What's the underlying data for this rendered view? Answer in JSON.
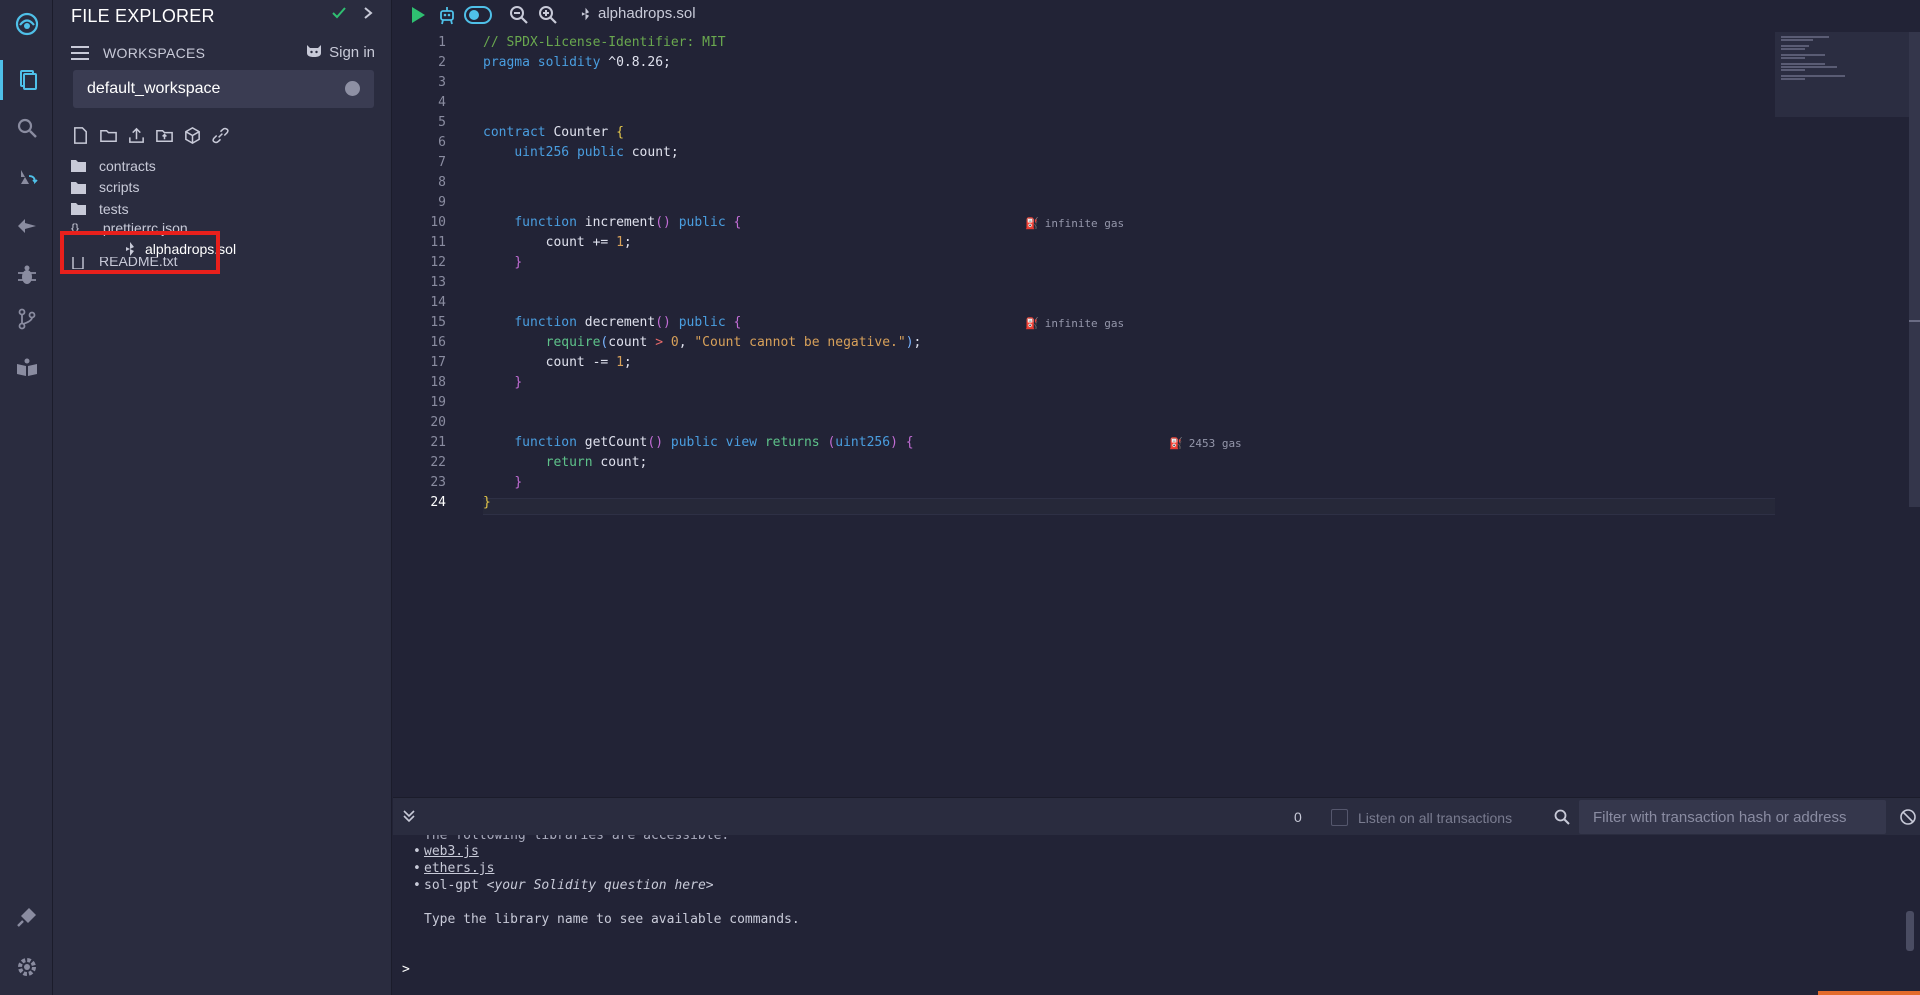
{
  "side_panel": {
    "title": "FILE EXPLORER",
    "workspaces_label": "WORKSPACES",
    "sign_in": "Sign in",
    "workspace_name": "default_workspace",
    "tree": [
      {
        "type": "folder",
        "name": "contracts"
      },
      {
        "type": "folder",
        "name": "scripts"
      },
      {
        "type": "folder",
        "name": "tests"
      },
      {
        "type": "file",
        "name": ".prettierrc.json"
      },
      {
        "type": "sol",
        "name": "alphadrops.sol"
      },
      {
        "type": "file",
        "name": "README.txt"
      }
    ]
  },
  "toolbar": {
    "open_file": "alphadrops.sol"
  },
  "editor": {
    "current_line": "24",
    "line_numbers": [
      "1",
      "2",
      "3",
      "4",
      "5",
      "6",
      "7",
      "8",
      "9",
      "10",
      "11",
      "12",
      "13",
      "14",
      "15",
      "16",
      "17",
      "18",
      "19",
      "20",
      "21",
      "22",
      "23",
      "24"
    ],
    "gas": {
      "increment": "infinite gas",
      "decrement": "infinite gas",
      "getCount": "2453 gas"
    },
    "code": {
      "l1": "// SPDX-License-Identifier: MIT",
      "l2_kw1": "pragma",
      "l2_kw2": "solidity",
      "l2_ver": "^0.8.26;",
      "l5_kw": "contract",
      "l5_name": "Counter",
      "l6_type": "uint256",
      "l6_mod": "public",
      "l6_var": "count;",
      "l9_fn": "function",
      "l9_name": "increment",
      "l9_mod": "public",
      "l10": "count += ",
      "l10_num": "1",
      "l14_fn": "function",
      "l14_name": "decrement",
      "l14_mod": "public",
      "l15_req": "require",
      "l15_arg": "count",
      "l15_op": ">",
      "l15_num": "0",
      "l15_str": "\"Count cannot be negative.\"",
      "l16": "count -= ",
      "l16_num": "1",
      "l20_fn": "function",
      "l20_name": "getCount",
      "l20_mod1": "public",
      "l20_mod2": "view",
      "l20_ret": "returns",
      "l20_type": "uint256",
      "l21_ret": "return",
      "l21_var": "count;"
    }
  },
  "terminal_bar": {
    "tx_count": "0",
    "listen_label": "Listen on all transactions",
    "filter_placeholder": "Filter with transaction hash or address"
  },
  "terminal": {
    "cut_line": "The following libraries are accessible:",
    "libs": [
      "web3.js",
      "ethers.js"
    ],
    "sol_gpt": "sol-gpt",
    "sol_gpt_hint": "<your Solidity question here>",
    "hint": "Type the library name to see available commands.",
    "prompt": ">"
  },
  "colors": {
    "accent": "#4fc0e8",
    "highlight_box": "#e8201c",
    "run_green": "#2fbf71"
  }
}
